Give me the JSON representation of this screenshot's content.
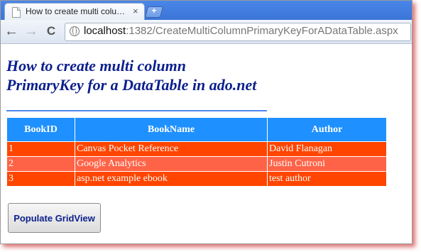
{
  "browser": {
    "tab_title": "How to create multi colu…",
    "tab_close": "×",
    "new_tab": "+",
    "back": "←",
    "forward": "→",
    "reload": "C",
    "url_host": "localhost",
    "url_path": ":1382/CreateMultiColumnPrimaryKeyForADataTable.aspx"
  },
  "page": {
    "title_line1": "How to create multi column",
    "title_line2": "PrimaryKey for a DataTable in ado.net"
  },
  "grid": {
    "columns": [
      "BookID",
      "BookName",
      "Author"
    ],
    "rows": [
      [
        "1",
        "Canvas Pocket Reference",
        "David Flanagan"
      ],
      [
        "2",
        "Google Analytics",
        "Justin Cutroni"
      ],
      [
        "3",
        "asp.net example ebook",
        "test author"
      ]
    ],
    "colors": {
      "header": "#1e90ff",
      "odd_row": "#ff4500",
      "even_row": "#ff6347"
    }
  },
  "actions": {
    "populate_label": "Populate GridView"
  },
  "icons": {
    "page": "page-icon",
    "globe": "globe-icon"
  }
}
